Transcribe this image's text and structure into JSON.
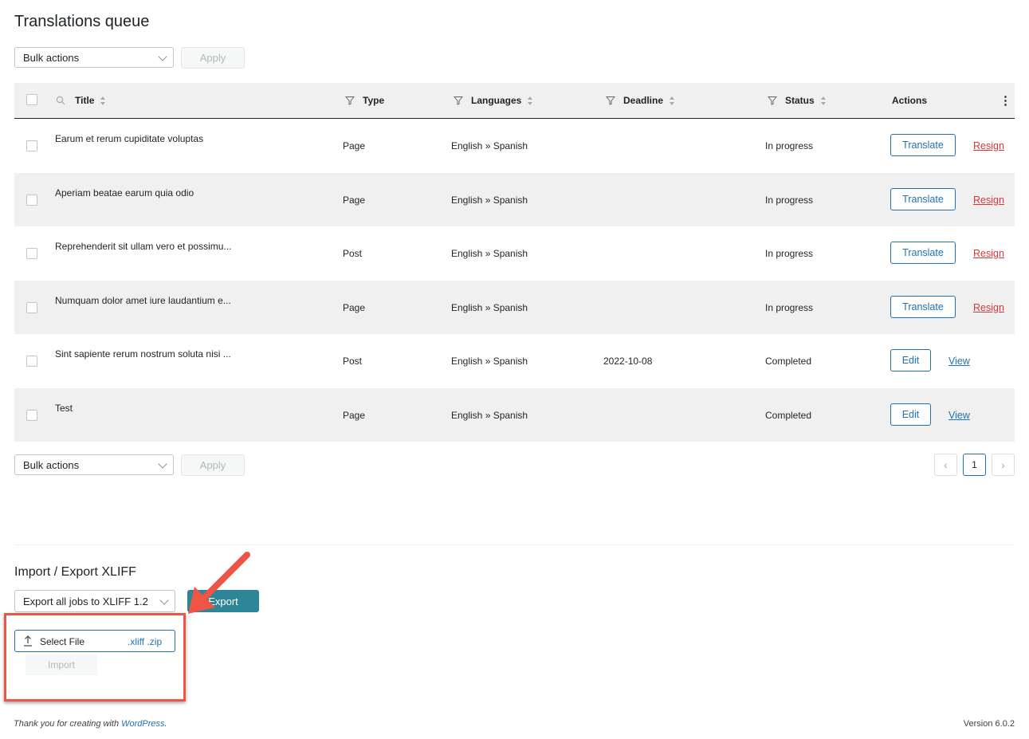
{
  "page": {
    "title": "Translations queue"
  },
  "bulk": {
    "select_label": "Bulk actions",
    "apply_label": "Apply"
  },
  "table": {
    "columns": {
      "title": "Title",
      "type": "Type",
      "languages": "Languages",
      "deadline": "Deadline",
      "status": "Status",
      "actions": "Actions"
    },
    "rows": [
      {
        "title": "Earum et rerum cupiditate voluptas",
        "type": "Page",
        "languages": "English » Spanish",
        "deadline": "",
        "status": "In progress",
        "primary": "Translate",
        "secondary": "Resign"
      },
      {
        "title": "Aperiam beatae earum quia odio",
        "type": "Page",
        "languages": "English » Spanish",
        "deadline": "",
        "status": "In progress",
        "primary": "Translate",
        "secondary": "Resign"
      },
      {
        "title": "Reprehenderit sit ullam vero et possimu...",
        "type": "Post",
        "languages": "English » Spanish",
        "deadline": "",
        "status": "In progress",
        "primary": "Translate",
        "secondary": "Resign"
      },
      {
        "title": "Numquam dolor amet iure laudantium e...",
        "type": "Page",
        "languages": "English » Spanish",
        "deadline": "",
        "status": "In progress",
        "primary": "Translate",
        "secondary": "Resign"
      },
      {
        "title": "Sint sapiente rerum nostrum soluta nisi ...",
        "type": "Post",
        "languages": "English » Spanish",
        "deadline": "2022-10-08",
        "status": "Completed",
        "primary": "Edit",
        "secondary": "View"
      },
      {
        "title": "Test",
        "type": "Page",
        "languages": "English » Spanish",
        "deadline": "",
        "status": "Completed",
        "primary": "Edit",
        "secondary": "View"
      }
    ]
  },
  "pagination": {
    "current_page": "1"
  },
  "xliff": {
    "title": "Import / Export XLIFF",
    "export_select": "Export all jobs to XLIFF 1.2",
    "export_button": "Export",
    "select_file": "Select File",
    "file_types": ".xliff .zip",
    "import_button": "Import"
  },
  "footer": {
    "thanks_prefix": "Thank you for creating with ",
    "thanks_link": "WordPress",
    "thanks_suffix": ".",
    "version": "Version 6.0.2"
  },
  "colors": {
    "accent_blue": "#2271b1",
    "resign_red": "#d63638",
    "export_teal": "#2d8597",
    "annotation_red": "#ee5547"
  }
}
